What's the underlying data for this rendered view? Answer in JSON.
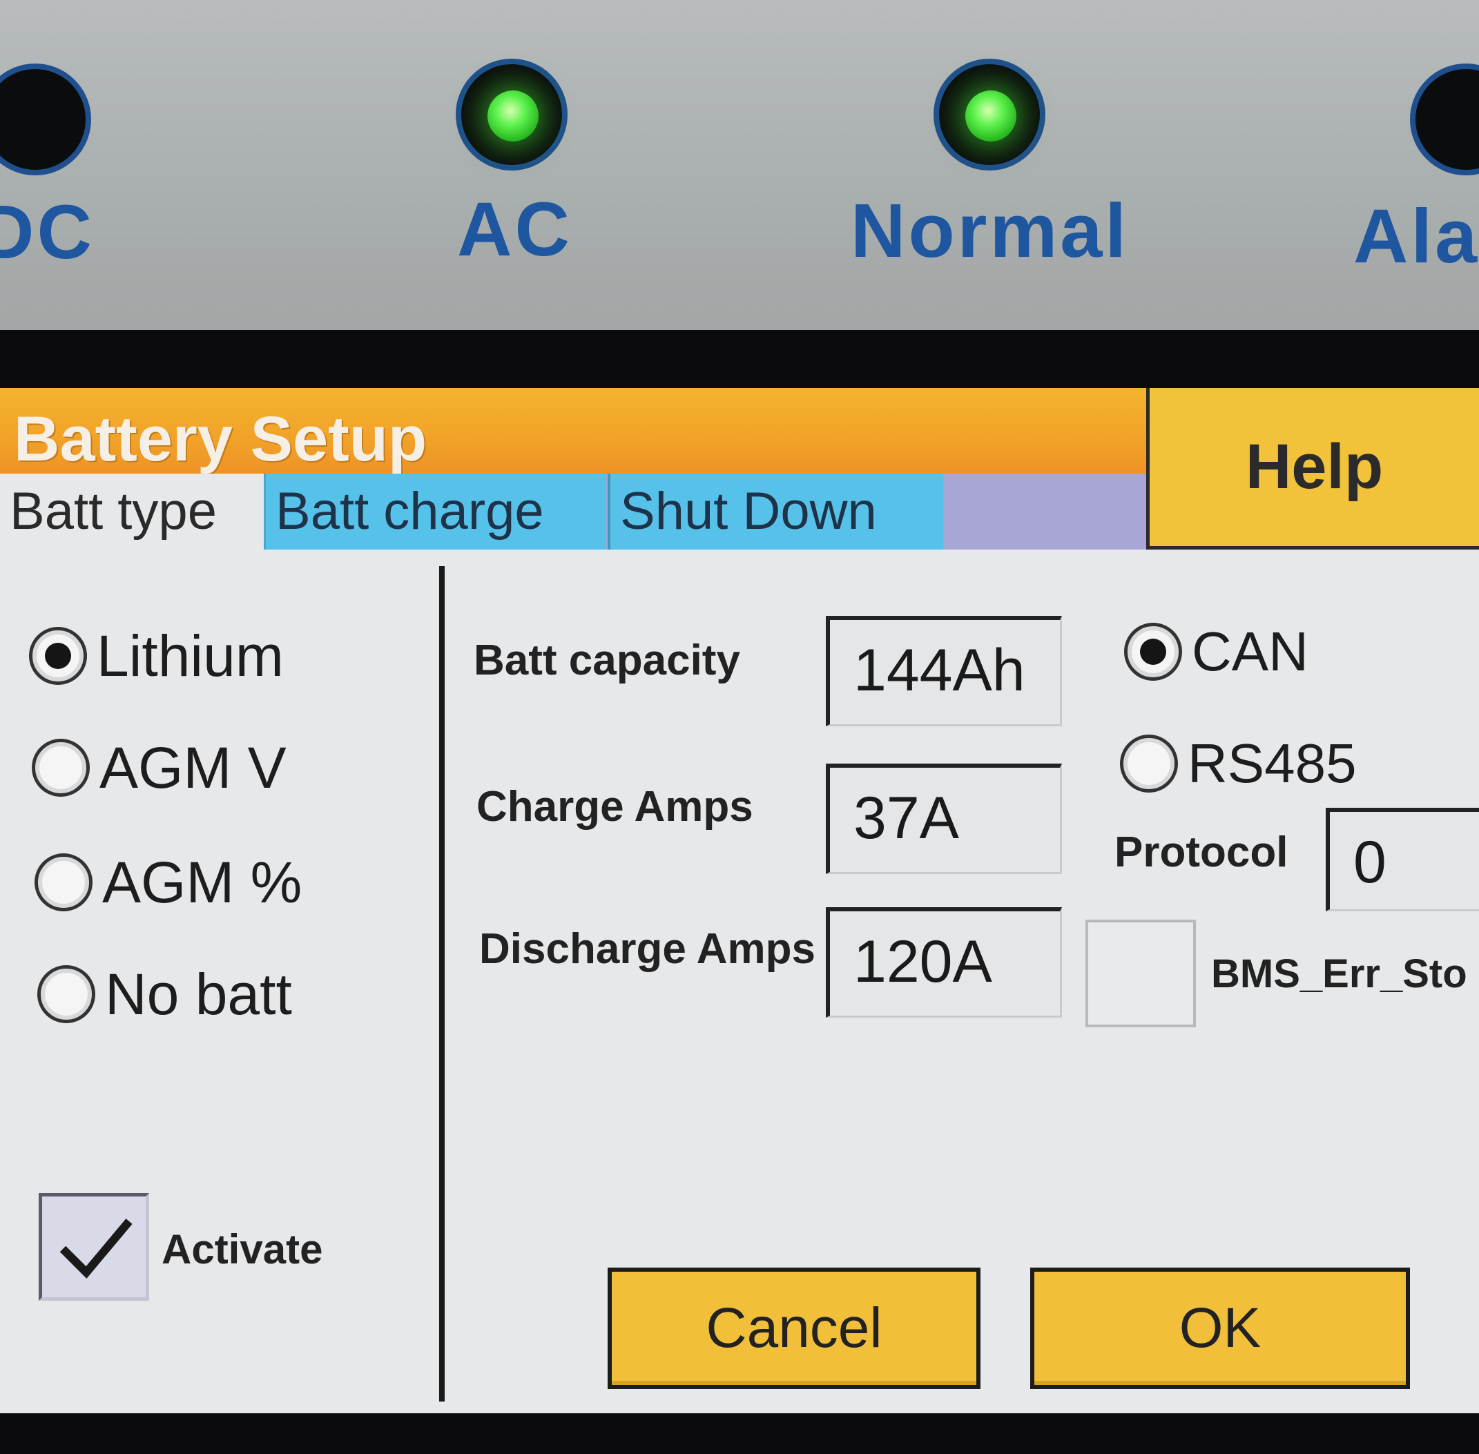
{
  "indicators": {
    "dc": {
      "label": "DC",
      "on": false
    },
    "ac": {
      "label": "AC",
      "on": true
    },
    "normal": {
      "label": "Normal",
      "on": true
    },
    "alarm": {
      "label": "Ala",
      "on": false
    }
  },
  "window": {
    "title": "Battery Setup",
    "help_label": "Help"
  },
  "tabs": [
    {
      "label": "Batt type",
      "active": true
    },
    {
      "label": "Batt charge",
      "active": false
    },
    {
      "label": "Shut Down",
      "active": false
    }
  ],
  "battery_type": {
    "options": [
      {
        "label": "Lithium",
        "selected": true
      },
      {
        "label": "AGM V",
        "selected": false
      },
      {
        "label": "AGM %",
        "selected": false
      },
      {
        "label": "No batt",
        "selected": false
      }
    ],
    "activate": {
      "label": "Activate",
      "checked": true
    }
  },
  "settings": {
    "capacity": {
      "label": "Batt capacity",
      "value": "144Ah"
    },
    "charge_amps": {
      "label": "Charge Amps",
      "value": "37A"
    },
    "discharge_amps": {
      "label": "Discharge Amps",
      "value": "120A"
    }
  },
  "comms": {
    "options": [
      {
        "label": "CAN",
        "selected": true
      },
      {
        "label": "RS485",
        "selected": false
      }
    ],
    "protocol": {
      "label": "Protocol",
      "value": "0"
    },
    "bms_err_stop": {
      "label": "BMS_Err_Sto",
      "checked": false
    }
  },
  "buttons": {
    "cancel_label": "Cancel",
    "ok_label": "OK"
  },
  "colors": {
    "title_bar": "#f1a228",
    "tab_inactive": "#56c2ea",
    "button": "#f1bf3a",
    "led_on": "#5ef24e",
    "label_blue": "#1f56a0"
  }
}
